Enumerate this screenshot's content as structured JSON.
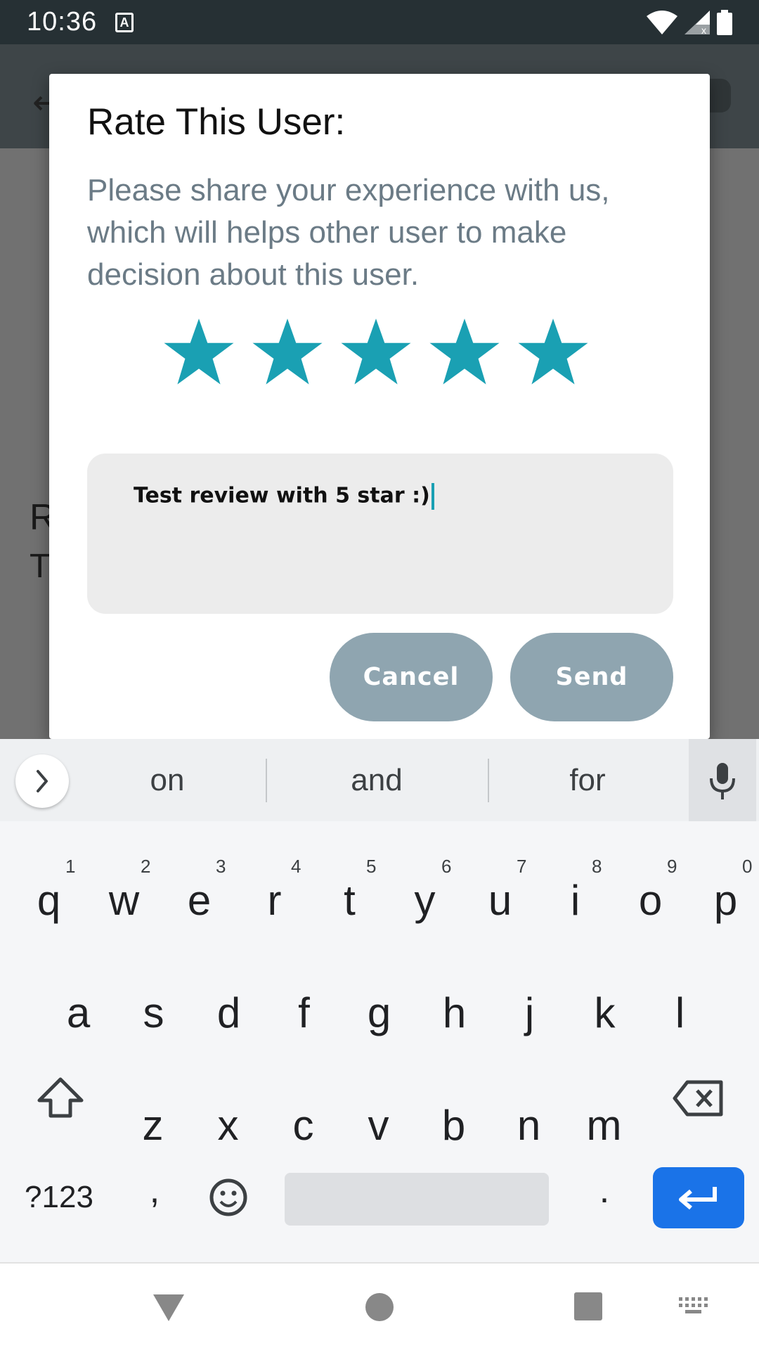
{
  "status_bar": {
    "time": "10:36",
    "keyboard_indicator": "A"
  },
  "background": {
    "partial_line1": "R",
    "partial_line2": "T"
  },
  "dialog": {
    "title": "Rate This User:",
    "message": "Please share your experience with us, which will helps other user to make decision about this user.",
    "rating": 5,
    "max_rating": 5,
    "star_color": "#1aa0b3",
    "review_text": "Test review with 5 star :)",
    "cancel_label": "Cancel",
    "send_label": "Send",
    "button_color": "#8fa5b0"
  },
  "keyboard": {
    "suggestions": [
      "on",
      "and",
      "for"
    ],
    "row1": [
      "q",
      "w",
      "e",
      "r",
      "t",
      "y",
      "u",
      "i",
      "o",
      "p"
    ],
    "row1_hints": [
      "1",
      "2",
      "3",
      "4",
      "5",
      "6",
      "7",
      "8",
      "9",
      "0"
    ],
    "row2": [
      "a",
      "s",
      "d",
      "f",
      "g",
      "h",
      "j",
      "k",
      "l"
    ],
    "row3": [
      "z",
      "x",
      "c",
      "v",
      "b",
      "n",
      "m"
    ],
    "symbols_label": "?123",
    "comma_label": ",",
    "period_label": ".",
    "enter_color": "#1a73e8"
  }
}
